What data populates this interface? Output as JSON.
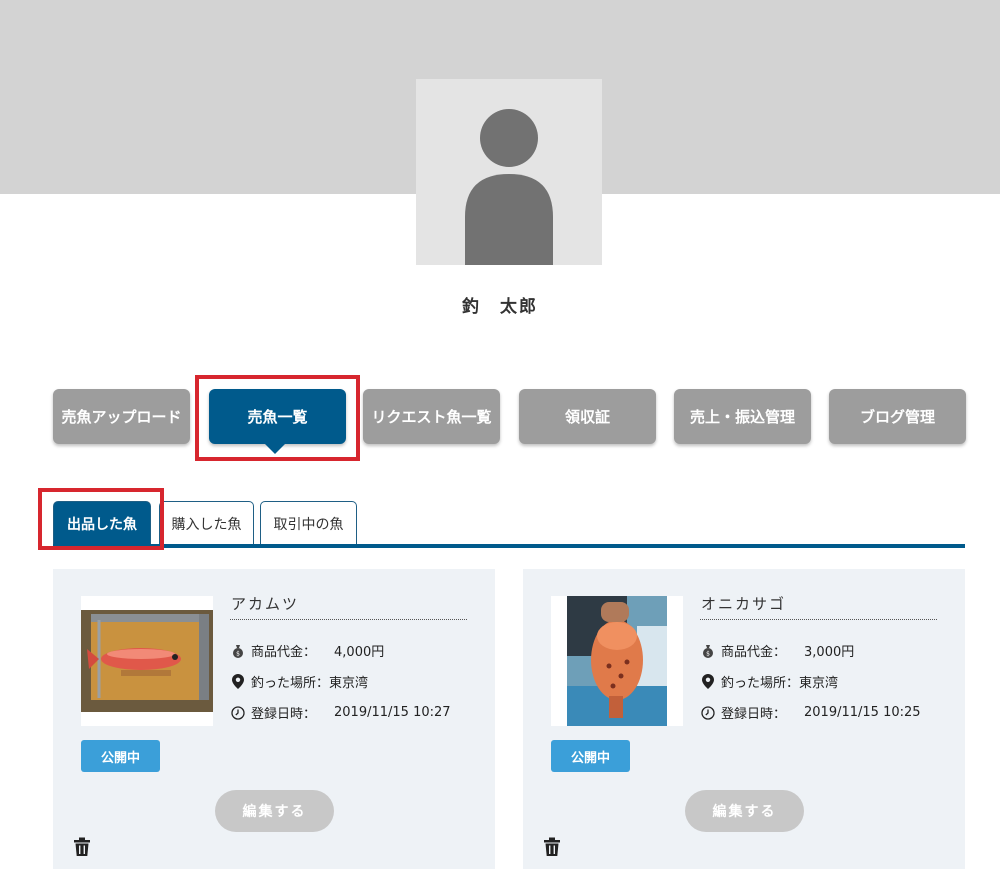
{
  "profile": {
    "name": "釣　太郎"
  },
  "menu": [
    {
      "label": "売魚アップロード"
    },
    {
      "label": "売魚一覧"
    },
    {
      "label": "リクエスト魚一覧"
    },
    {
      "label": "領収証"
    },
    {
      "label": "売上・振込管理"
    },
    {
      "label": "ブログ管理"
    }
  ],
  "subtabs": [
    {
      "label": "出品した魚"
    },
    {
      "label": "購入した魚"
    },
    {
      "label": "取引中の魚"
    }
  ],
  "listings": [
    {
      "name": "アカムツ",
      "price_label": "商品代金：",
      "price": "4,000円",
      "place_label": "釣った場所：",
      "place": "東京湾",
      "date_label": "登録日時：",
      "date": "2019/11/15 10:27",
      "status": "公開中",
      "edit_label": "編集する"
    },
    {
      "name": "オニカサゴ",
      "price_label": "商品代金：",
      "price": "3,000円",
      "place_label": "釣った場所：",
      "place": "東京湾",
      "date_label": "登録日時：",
      "date": "2019/11/15 10:25",
      "status": "公開中",
      "edit_label": "編集する"
    }
  ],
  "colors": {
    "primary": "#005a8c",
    "inactive_button": "#9d9d9d",
    "badge": "#3b9fd9",
    "highlight": "#d7262e"
  }
}
